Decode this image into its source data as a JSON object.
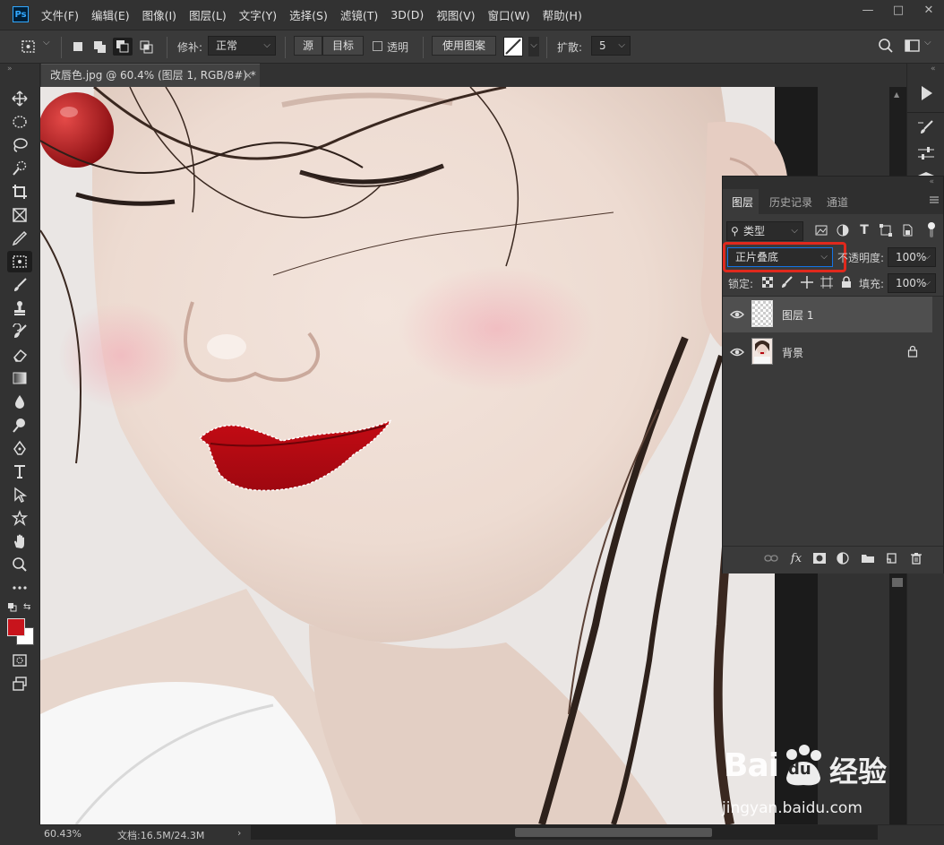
{
  "app": {
    "logo": "Ps"
  },
  "menu": [
    "文件(F)",
    "编辑(E)",
    "图像(I)",
    "图层(L)",
    "文字(Y)",
    "选择(S)",
    "滤镜(T)",
    "3D(D)",
    "视图(V)",
    "窗口(W)",
    "帮助(H)"
  ],
  "window_controls": {
    "minimize": "—",
    "maximize": "□",
    "close": "✕"
  },
  "options": {
    "patch_label": "修补:",
    "patch_mode": "正常",
    "source_btn": "源",
    "target_btn": "目标",
    "transparent_label": "透明",
    "use_pattern_btn": "使用图案",
    "diffuse_label": "扩散:",
    "diffuse_value": "5"
  },
  "document_tab": {
    "title": "改唇色.jpg @ 60.4% (图层 1, RGB/8#) *",
    "close": "×"
  },
  "layers_panel": {
    "tabs": [
      "图层",
      "历史记录",
      "通道"
    ],
    "filter_kind": "类型",
    "blend_mode": "正片叠底",
    "opacity_label": "不透明度:",
    "opacity_value": "100%",
    "lock_label": "锁定:",
    "fill_label": "填充:",
    "fill_value": "100%",
    "layers": [
      {
        "name": "图层 1",
        "selected": true,
        "locked": false
      },
      {
        "name": "背景",
        "selected": false,
        "locked": true
      }
    ]
  },
  "status": {
    "zoom": "60.43%",
    "doc_size": "文档:16.5M/24.3M"
  },
  "watermark": {
    "brand_latin": "Bai",
    "brand_du": "du",
    "brand_cn": "经验",
    "url": "jingyan.baidu.com"
  },
  "colors": {
    "highlight": "#e0291d",
    "foreground": "#c8141c",
    "background": "#ffffff",
    "lip": "#b5060f",
    "accent": "#1473e6"
  }
}
